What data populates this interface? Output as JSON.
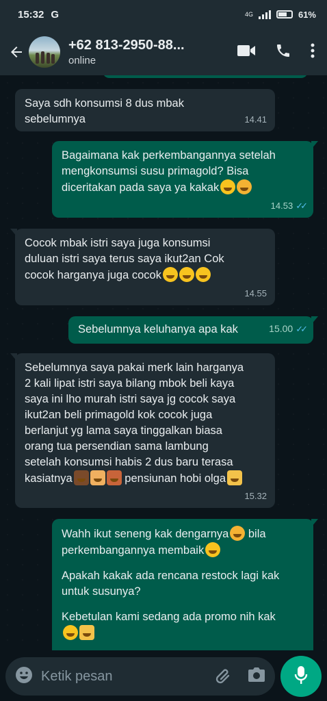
{
  "status_bar": {
    "time": "15:32",
    "carrier_glyph": "G",
    "network": "4G",
    "battery": "61%",
    "battery_level": 0.61
  },
  "header": {
    "contact_name": "+62 813-2950-88...",
    "subtitle": "online"
  },
  "messages": [
    {
      "direction": "in",
      "text": "Saya sdh konsumsi 8 dus mbak\nsebelumnya",
      "time": "14.41"
    },
    {
      "direction": "out",
      "text": "Bagaimana kak perkembangannya setelah\nmengkonsumsi susu primagold? Bisa\ndiceritakan pada saya ya kakak",
      "time": "14.53",
      "status": "read"
    },
    {
      "direction": "in",
      "text": "Cocok mbak istri saya juga konsumsi\nduluan istri saya terus saya ikut2an Cok\ncocok harganya juga cocok",
      "time": "14.55"
    },
    {
      "direction": "out",
      "text": "Sebelumnya keluhanya apa kak",
      "time": "15.00",
      "status": "read"
    },
    {
      "direction": "in",
      "text": "Sebelumnya saya pakai merk lain harganya\n2 kali lipat istri saya bilang mbok beli kaya\nsaya ini lho murah istri saya jg cocok saya\nikut2an beli primagold kok cocok juga\nberlanjut yg lama saya tinggalkan biasa\norang tua persendian sama lambung\nsetelah konsumsi habis 2 dus baru terasa\nkasiatnya",
      "suffix": " pensiunan hobi olga",
      "time": "15.32"
    },
    {
      "direction": "out",
      "text": "Wahh ikut seneng kak dengarnya",
      "suffix": " bila\nperkembangannya membaik",
      "text2": "Apakah kakak ada rencana restock lagi kak\nuntuk susunya?",
      "text3": "Kebetulan kami sedang ada promo nih kak"
    }
  ],
  "input": {
    "placeholder": "Ketik pesan"
  },
  "icons": [
    "back-arrow-icon",
    "video-call-icon",
    "phone-icon",
    "more-vert-icon",
    "emoji-icon",
    "attach-icon",
    "camera-icon",
    "mic-icon"
  ],
  "colors": {
    "header_bg": "#1f2c33",
    "incoming_bubble": "#202c33",
    "outgoing_bubble": "#005c4b",
    "accent": "#00a884",
    "read_ticks": "#53bdeb"
  }
}
